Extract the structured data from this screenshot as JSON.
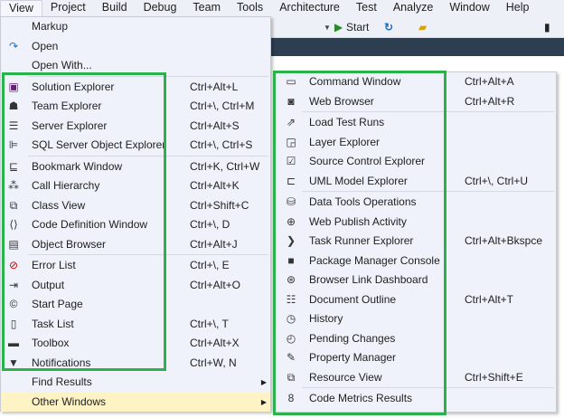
{
  "menubar": [
    "View",
    "Project",
    "Build",
    "Debug",
    "Team",
    "Tools",
    "Architecture",
    "Test",
    "Analyze",
    "Window",
    "Help"
  ],
  "toolbar": {
    "start_label": "Start"
  },
  "view_menu": [
    {
      "label": "Markup",
      "icon": "none"
    },
    {
      "label": "Open",
      "icon": "redo-arrow-icon",
      "glyph": "↷",
      "color": "#1e6fc8"
    },
    {
      "label": "Open With..."
    },
    {
      "sep": true
    },
    {
      "label": "Solution Explorer",
      "shortcut": "Ctrl+Alt+L",
      "icon": "solution-explorer-icon",
      "glyph": "▣",
      "color": "#68217a"
    },
    {
      "label": "Team Explorer",
      "shortcut": "Ctrl+\\, Ctrl+M",
      "icon": "team-explorer-icon",
      "glyph": "☗"
    },
    {
      "label": "Server Explorer",
      "shortcut": "Ctrl+Alt+S",
      "icon": "server-explorer-icon",
      "glyph": "☰"
    },
    {
      "label": "SQL Server Object Explorer",
      "shortcut": "Ctrl+\\, Ctrl+S",
      "icon": "sql-server-icon",
      "glyph": "⊫"
    },
    {
      "sep": true
    },
    {
      "label": "Bookmark Window",
      "shortcut": "Ctrl+K, Ctrl+W",
      "icon": "bookmark-window-icon",
      "glyph": "⊑"
    },
    {
      "label": "Call Hierarchy",
      "shortcut": "Ctrl+Alt+K",
      "icon": "call-hierarchy-icon",
      "glyph": "⁂"
    },
    {
      "label": "Class View",
      "shortcut": "Ctrl+Shift+C",
      "icon": "class-view-icon",
      "glyph": "⧉"
    },
    {
      "label": "Code Definition Window",
      "shortcut": "Ctrl+\\, D",
      "icon": "code-definition-icon",
      "glyph": "⟨⟩"
    },
    {
      "label": "Object Browser",
      "shortcut": "Ctrl+Alt+J",
      "icon": "object-browser-icon",
      "glyph": "▤"
    },
    {
      "sep": true
    },
    {
      "label": "Error List",
      "shortcut": "Ctrl+\\, E",
      "icon": "error-list-icon",
      "glyph": "⊘",
      "color": "#c00"
    },
    {
      "label": "Output",
      "shortcut": "Ctrl+Alt+O",
      "icon": "output-icon",
      "glyph": "⇥"
    },
    {
      "label": "Start Page",
      "icon": "start-page-icon",
      "glyph": "©"
    },
    {
      "label": "Task List",
      "shortcut": "Ctrl+\\, T",
      "icon": "task-list-icon",
      "glyph": "▯"
    },
    {
      "label": "Toolbox",
      "shortcut": "Ctrl+Alt+X",
      "icon": "toolbox-icon",
      "glyph": "▬"
    },
    {
      "label": "Notifications",
      "shortcut": "Ctrl+W, N",
      "icon": "notifications-icon",
      "glyph": "▼"
    },
    {
      "label": "Find Results",
      "submenu": true
    },
    {
      "label": "Other Windows",
      "submenu": true,
      "highlight": true
    }
  ],
  "other_windows_menu": [
    {
      "label": "Command Window",
      "shortcut": "Ctrl+Alt+A",
      "icon": "command-window-icon",
      "glyph": "▭"
    },
    {
      "label": "Web Browser",
      "shortcut": "Ctrl+Alt+R",
      "icon": "web-browser-icon",
      "glyph": "◙"
    },
    {
      "sep": true
    },
    {
      "label": "Load Test Runs",
      "icon": "load-test-icon",
      "glyph": "⇗"
    },
    {
      "label": "Layer Explorer",
      "icon": "layer-explorer-icon",
      "glyph": "◲"
    },
    {
      "label": "Source Control Explorer",
      "icon": "source-control-icon",
      "glyph": "☑"
    },
    {
      "label": "UML Model Explorer",
      "shortcut": "Ctrl+\\, Ctrl+U",
      "icon": "uml-model-icon",
      "glyph": "⊏"
    },
    {
      "sep": true
    },
    {
      "label": "Data Tools Operations",
      "icon": "data-tools-icon",
      "glyph": "⛁"
    },
    {
      "label": "Web Publish Activity",
      "icon": "web-publish-icon",
      "glyph": "⊕"
    },
    {
      "label": "Task Runner Explorer",
      "shortcut": "Ctrl+Alt+Bkspce",
      "icon": "task-runner-icon",
      "glyph": "❯"
    },
    {
      "label": "Package Manager Console",
      "icon": "package-manager-icon",
      "glyph": "■"
    },
    {
      "label": "Browser Link Dashboard",
      "icon": "browser-link-icon",
      "glyph": "⊛"
    },
    {
      "label": "Document Outline",
      "shortcut": "Ctrl+Alt+T",
      "icon": "document-outline-icon",
      "glyph": "☷"
    },
    {
      "label": "History",
      "icon": "history-icon",
      "glyph": "◷"
    },
    {
      "label": "Pending Changes",
      "icon": "pending-changes-icon",
      "glyph": "◴"
    },
    {
      "label": "Property Manager",
      "icon": "wrench-icon",
      "glyph": "✎"
    },
    {
      "label": "Resource View",
      "shortcut": "Ctrl+Shift+E",
      "icon": "resource-view-icon",
      "glyph": "⧉"
    },
    {
      "sep": true
    },
    {
      "label": "Code Metrics Results",
      "icon": "code-metrics-icon",
      "glyph": "8"
    }
  ],
  "colors": {
    "highlight_box": "#2bb24c",
    "menu_bg": "#f0f2fb",
    "hover": "#fdf3c5"
  }
}
